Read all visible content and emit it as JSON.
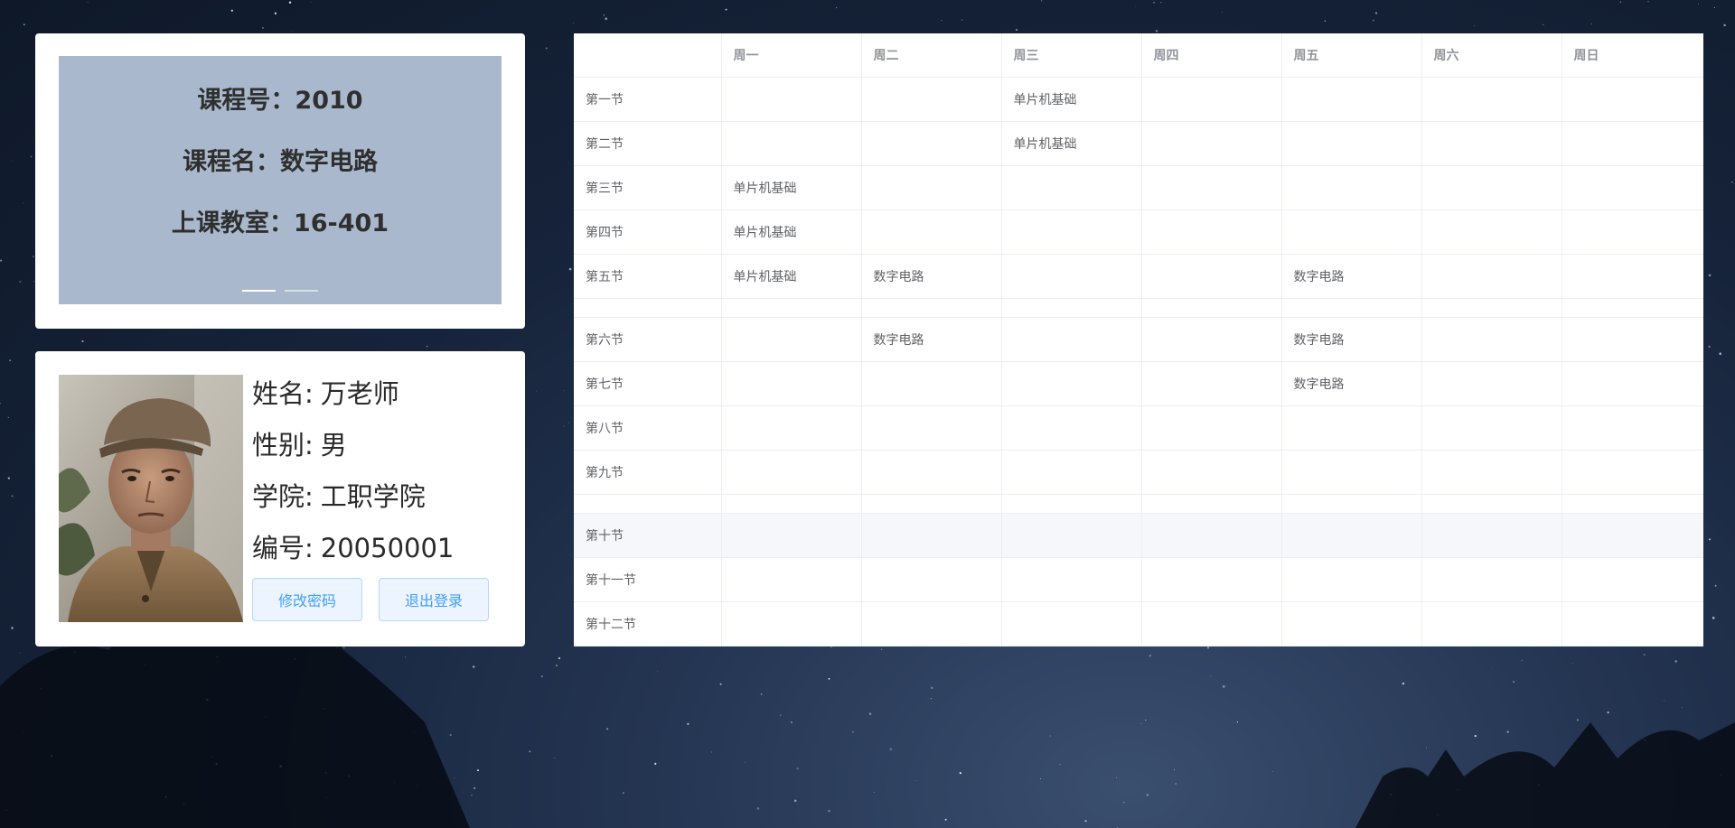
{
  "course_carousel": {
    "lines": [
      "课程号：2010",
      "课程名：数字电路",
      "上课教室：16-401"
    ],
    "slide_count": 2,
    "active_slide": 1
  },
  "teacher": {
    "name_label": "姓名:",
    "name_value": "万老师",
    "gender_label": "性别:",
    "gender_value": "男",
    "college_label": "学院:",
    "college_value": "工职学院",
    "id_label": "编号:",
    "id_value": "20050001",
    "avatar_icon": "teacher-avatar-photo"
  },
  "actions": {
    "change_password": "修改密码",
    "logout": "退出登录"
  },
  "timetable": {
    "days": [
      "周一",
      "周二",
      "周三",
      "周四",
      "周五",
      "周六",
      "周日"
    ],
    "rows": [
      {
        "period": "第一节",
        "cells": [
          "",
          "",
          "单片机基础",
          "",
          "",
          "",
          ""
        ]
      },
      {
        "period": "第二节",
        "cells": [
          "",
          "",
          "单片机基础",
          "",
          "",
          "",
          ""
        ]
      },
      {
        "period": "第三节",
        "cells": [
          "单片机基础",
          "",
          "",
          "",
          "",
          "",
          ""
        ]
      },
      {
        "period": "第四节",
        "cells": [
          "单片机基础",
          "",
          "",
          "",
          "",
          "",
          ""
        ]
      },
      {
        "period": "第五节",
        "cells": [
          "单片机基础",
          "数字电路",
          "",
          "",
          "数字电路",
          "",
          ""
        ]
      },
      {
        "period": "",
        "cells": [
          "",
          "",
          "",
          "",
          "",
          "",
          ""
        ],
        "spacer": true
      },
      {
        "period": "第六节",
        "cells": [
          "",
          "数字电路",
          "",
          "",
          "数字电路",
          "",
          ""
        ]
      },
      {
        "period": "第七节",
        "cells": [
          "",
          "",
          "",
          "",
          "数字电路",
          "",
          ""
        ]
      },
      {
        "period": "第八节",
        "cells": [
          "",
          "",
          "",
          "",
          "",
          "",
          ""
        ]
      },
      {
        "period": "第九节",
        "cells": [
          "",
          "",
          "",
          "",
          "",
          "",
          ""
        ]
      },
      {
        "period": "",
        "cells": [
          "",
          "",
          "",
          "",
          "",
          "",
          ""
        ],
        "spacer": true
      },
      {
        "period": "第十节",
        "cells": [
          "",
          "",
          "",
          "",
          "",
          "",
          ""
        ],
        "highlight": true
      },
      {
        "period": "第十一节",
        "cells": [
          "",
          "",
          "",
          "",
          "",
          "",
          ""
        ]
      },
      {
        "period": "第十二节",
        "cells": [
          "",
          "",
          "",
          "",
          "",
          "",
          ""
        ]
      }
    ]
  },
  "colors": {
    "button_bg": "#ecf5ff",
    "button_text": "#409eff",
    "carousel_bg": "#a9b8cc"
  }
}
